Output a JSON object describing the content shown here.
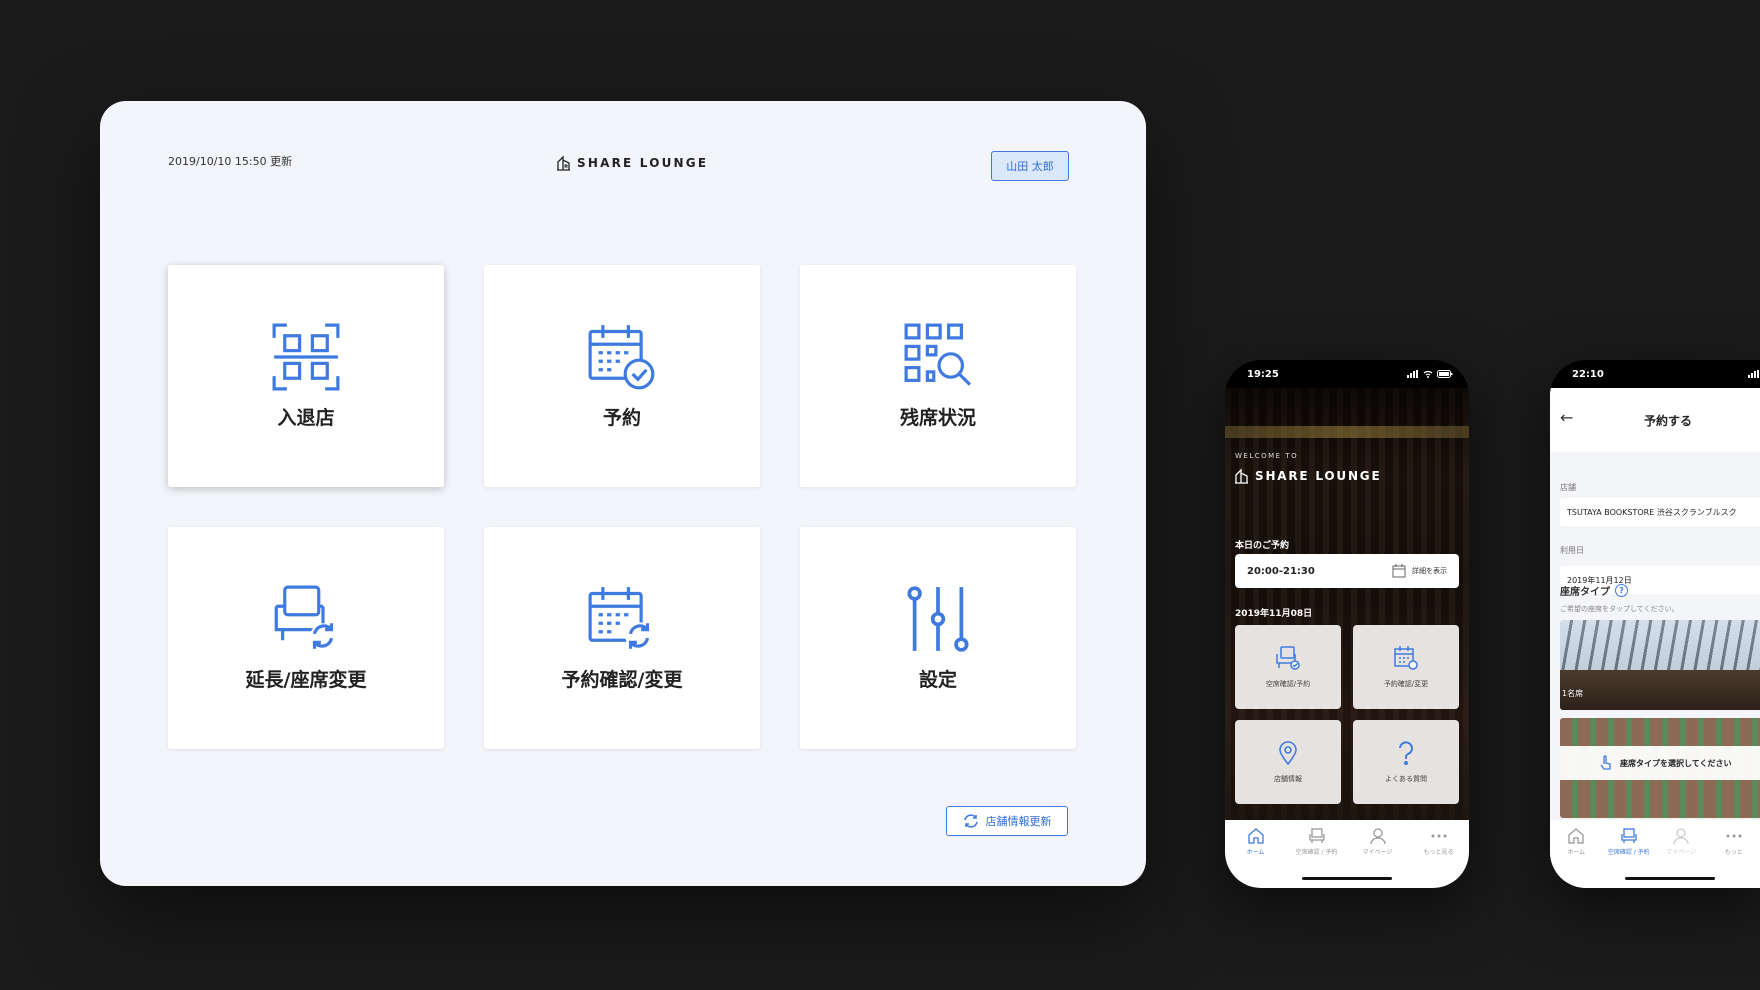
{
  "tablet": {
    "updated_text": "2019/10/10 15:50 更新",
    "logo_text": "SHARE LOUNGE",
    "user_name": "山田 太郎",
    "cards": [
      {
        "label": "入退店",
        "icon": "qr-code-icon"
      },
      {
        "label": "予約",
        "icon": "calendar-check-icon"
      },
      {
        "label": "残席状況",
        "icon": "grid-search-icon"
      },
      {
        "label": "延長/座席変更",
        "icon": "seat-refresh-icon"
      },
      {
        "label": "予約確認/変更",
        "icon": "calendar-refresh-icon"
      },
      {
        "label": "設定",
        "icon": "sliders-icon"
      }
    ],
    "refresh_label": "店舗情報更新"
  },
  "phone1": {
    "status_time": "19:25",
    "welcome": "WELCOME TO",
    "logo_text": "SHARE LOUNGE",
    "today_heading": "本日のご予約",
    "reservation_time": "20:00-21:30",
    "detail_label": "詳細を表示",
    "date_heading": "2019年11月08日",
    "tiles": [
      {
        "label": "空席確認/予約",
        "icon": "seat-check-icon"
      },
      {
        "label": "予約確認/変更",
        "icon": "calendar-refresh-icon"
      },
      {
        "label": "店舗情報",
        "icon": "location-pin-icon"
      },
      {
        "label": "よくある質問",
        "icon": "question-icon"
      }
    ],
    "tabs": [
      {
        "label": "ホーム",
        "icon": "home-icon"
      },
      {
        "label": "空席確認 / 予約",
        "icon": "seat-icon"
      },
      {
        "label": "マイページ",
        "icon": "person-icon"
      },
      {
        "label": "もっと見る",
        "icon": "more-icon"
      }
    ]
  },
  "phone2": {
    "status_time": "22:10",
    "back_glyph": "←",
    "title": "予約する",
    "store_label": "店舗",
    "store_value": "TSUTAYA BOOKSTORE 渋谷スクランブルスク",
    "date_label": "利用日",
    "date_value": "2019年11月12日",
    "seat_type_heading": "座席タイプ",
    "help_glyph": "?",
    "seat_hint": "ご希望の座席をタップしてください。",
    "photo_label": "1名席",
    "toast": "座席タイプを選択してください",
    "tabs": [
      {
        "label": "ホーム",
        "icon": "home-icon"
      },
      {
        "label": "空席確認 / 予約",
        "icon": "seat-icon"
      },
      {
        "label": "マイページ",
        "icon": "person-icon"
      },
      {
        "label": "もっと",
        "icon": "more-icon"
      }
    ]
  },
  "colors": {
    "accent": "#3f7ae0",
    "tablet_bg": "#f3f5fa",
    "page_bg": "#1b1b1b"
  }
}
